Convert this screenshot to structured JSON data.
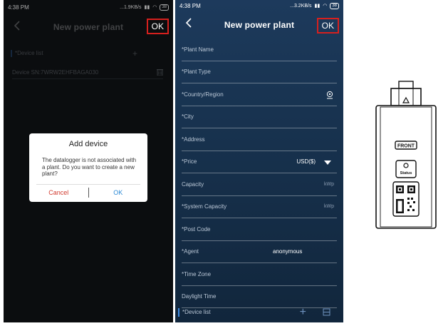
{
  "left_phone": {
    "status": {
      "time": "4:38 PM",
      "speed": "...1.9KB/s",
      "battery": "38"
    },
    "header": {
      "title": "New power plant",
      "ok_label": "OK"
    },
    "device_list_label": "*Device list",
    "device_row_text": "Device SN:7WRW2EHFBAGA030",
    "dialog": {
      "title": "Add device",
      "message": "The datalogger is not associated with a plant. Do you want to create a new plant?",
      "cancel_label": "Cancel",
      "ok_label": "OK"
    }
  },
  "right_phone": {
    "status": {
      "time": "4:38 PM",
      "speed": "...3.2KB/s",
      "battery": "38"
    },
    "header": {
      "title": "New power plant",
      "ok_label": "OK"
    },
    "fields": {
      "plant_name": "*Plant Name",
      "plant_type": "*Plant Type",
      "country": "*Country/Region",
      "city": "*City",
      "address": "*Address",
      "price": "*Price",
      "price_value": "USD($)",
      "capacity": "Capacity",
      "capacity_unit": "kWp",
      "system_capacity": "*System Capacity",
      "system_capacity_unit": "kWp",
      "post_code": "*Post Code",
      "agent": "*Agent",
      "agent_value": "anonymous",
      "time_zone": "*Time Zone",
      "daylight_time": "Daylight Time"
    },
    "device_list_label": "*Device list"
  },
  "device_illustration": {
    "front_label": "FRONT",
    "status_label": "Status"
  },
  "colors": {
    "highlight_box": "#d6201e",
    "accent_blue": "#3f8ae0",
    "dialog_cancel": "#d23b2f",
    "dialog_ok": "#2c8ad6"
  }
}
